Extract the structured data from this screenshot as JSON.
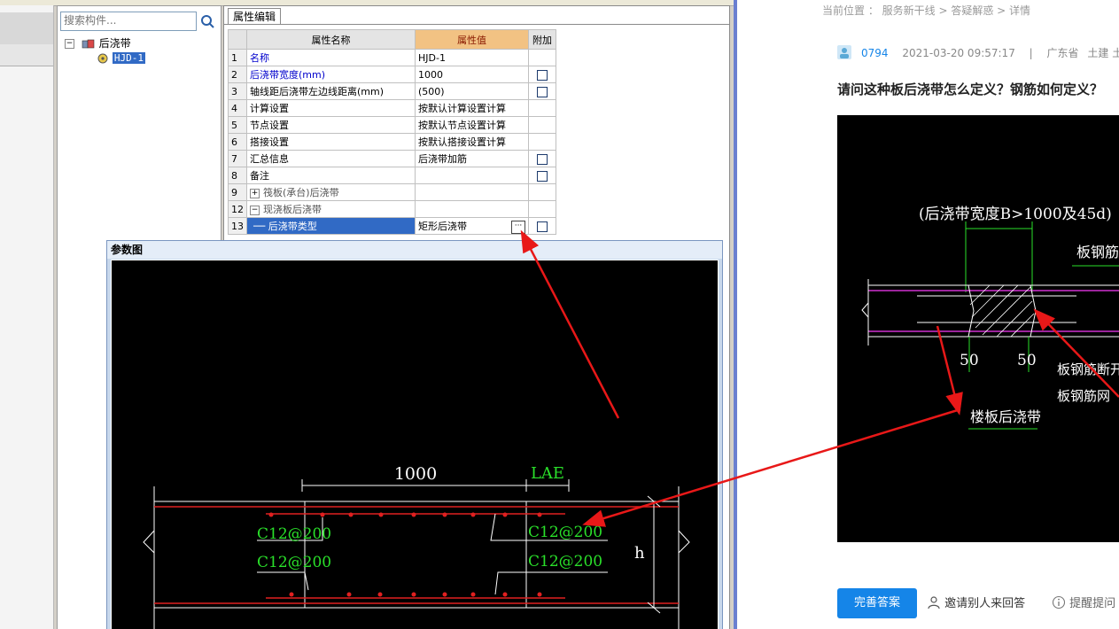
{
  "search": {
    "placeholder": "搜索构件..."
  },
  "tree": {
    "root_label": "后浇带",
    "child_label": "HJD-1"
  },
  "props": {
    "tab_label": "属性编辑",
    "headers": {
      "name": "属性名称",
      "value": "属性值",
      "extra": "附加"
    },
    "rows": [
      {
        "num": "1",
        "name": "名称",
        "value": "HJD-1",
        "checkbox": false
      },
      {
        "num": "2",
        "name": "后浇带宽度(mm)",
        "value": "1000",
        "checkbox": true
      },
      {
        "num": "3",
        "name": "轴线距后浇带左边线距离(mm)",
        "value": "(500)",
        "checkbox": true
      },
      {
        "num": "4",
        "name": "计算设置",
        "value": "按默认计算设置计算",
        "checkbox": false
      },
      {
        "num": "5",
        "name": "节点设置",
        "value": "按默认节点设置计算",
        "checkbox": false
      },
      {
        "num": "6",
        "name": "搭接设置",
        "value": "按默认搭接设置计算",
        "checkbox": false
      },
      {
        "num": "7",
        "name": "汇总信息",
        "value": "后浇带加筋",
        "checkbox": true
      },
      {
        "num": "8",
        "name": "备注",
        "value": "",
        "checkbox": true
      },
      {
        "num": "9",
        "name": "筏板(承台)后浇带",
        "value": "",
        "checkbox": false
      },
      {
        "num": "12",
        "name": "现浇板后浇带",
        "value": "",
        "checkbox": false
      },
      {
        "num": "13",
        "name": "后浇带类型",
        "value": "矩形后浇带",
        "checkbox": true
      }
    ],
    "ellipsis": "···"
  },
  "param_window": {
    "title": "参数图",
    "labels": {
      "width": "1000",
      "lae": "LAE",
      "top_left": "C12@200",
      "bottom_left": "C12@200",
      "top_right": "C12@200",
      "bottom_right": "C12@200",
      "h": "h"
    }
  },
  "web": {
    "breadcrumb": "当前位置 ： 服务新干线 > 答疑解惑 > 详情",
    "user": "0794",
    "datetime": "2021-03-20 09:57:17",
    "separator": "|",
    "region": "广东省",
    "tags": "土建 土建",
    "question": "请问这种板后浇带怎么定义？钢筋如何定义？",
    "image_labels": {
      "width_note": "(后浇带宽度B>1000及45d)",
      "slab_pull": "板钢筋拉",
      "fifty_left": "50",
      "fifty_right": "50",
      "slab_open": "板钢筋断开时",
      "slab_mesh": "板钢筋网",
      "floor_band": "楼板后浇带"
    },
    "answer_button": "完善答案",
    "invite": "邀请别人来回答",
    "remind": "提醒提问"
  }
}
